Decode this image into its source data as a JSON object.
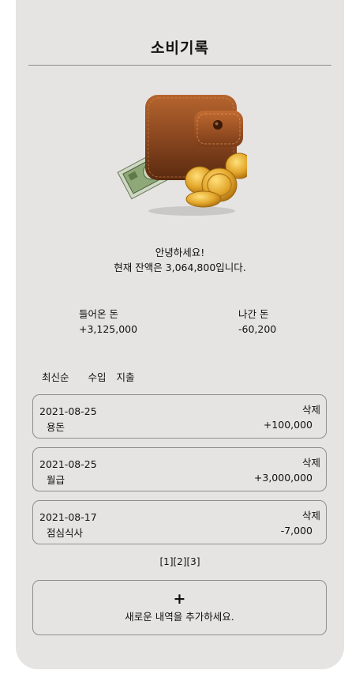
{
  "header": {
    "title": "소비기록"
  },
  "greeting": {
    "line1": "안녕하세요!",
    "line2": "현재 잔액은 3,064,800입니다."
  },
  "summary": {
    "income_label": "들어온 돈",
    "income_value": "+3,125,000",
    "expense_label": "나간 돈",
    "expense_value": "-60,200"
  },
  "filters": [
    "최신순",
    "수입",
    "지출"
  ],
  "records": [
    {
      "date": "2021-08-25",
      "name": "용돈",
      "delete_label": "삭제",
      "amount": "+100,000"
    },
    {
      "date": "2021-08-25",
      "name": "월급",
      "delete_label": "삭제",
      "amount": "+3,000,000"
    },
    {
      "date": "2021-08-17",
      "name": "점심식사",
      "delete_label": "삭제",
      "amount": "-7,000"
    }
  ],
  "pagination": [
    "[1]",
    "[2]",
    "[3]"
  ],
  "add": {
    "plus": "+",
    "message": "새로운 내역을 추가하세요."
  },
  "colors": {
    "background": "#e6e4e3",
    "border": "#8e8e8e",
    "wallet": "#7a3f1c",
    "coin": "#e2a52a"
  },
  "icons": {
    "wallet": "wallet-icon"
  }
}
